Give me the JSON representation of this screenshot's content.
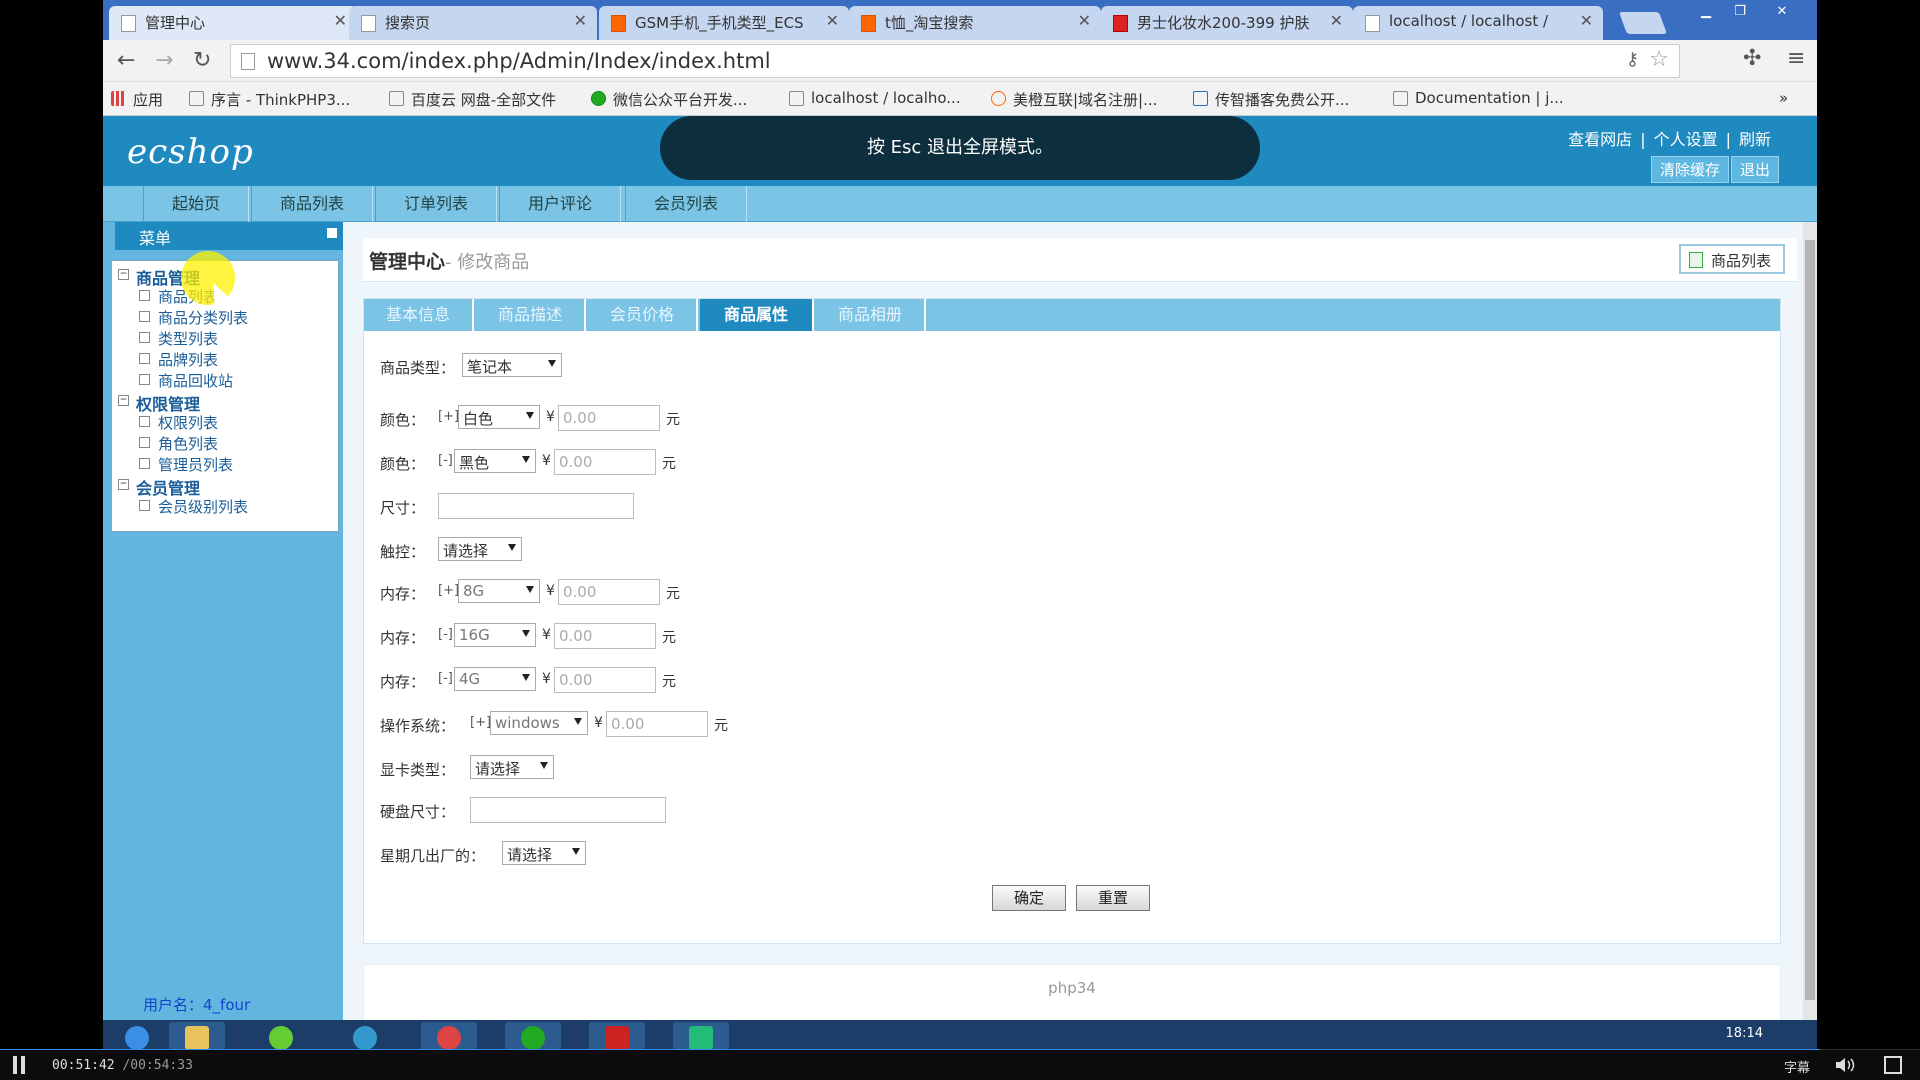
{
  "browser": {
    "tabs": [
      {
        "label": "管理中心",
        "active": true
      },
      {
        "label": "搜索页",
        "active": false
      },
      {
        "label": "GSM手机_手机类型_ECS",
        "active": false
      },
      {
        "label": "t恤_淘宝搜索",
        "active": false
      },
      {
        "label": "男士化妆水200-399 护肤",
        "active": false
      },
      {
        "label": "localhost / localhost / ",
        "active": false
      }
    ],
    "url": "www.34.com/index.php/Admin/Index/index.html",
    "bookmarks": [
      "应用",
      "序言 - ThinkPHP3...",
      "百度云 网盘-全部文件",
      "微信公众平台开发...",
      "localhost / localho...",
      "美橙互联|域名注册|...",
      "传智播客免费公开...",
      "Documentation | j..."
    ]
  },
  "esc_toast": "按 Esc 退出全屏模式。",
  "header": {
    "logo": "ecshop",
    "links": [
      "查看网店",
      "个人设置",
      "刷新"
    ],
    "buttons": [
      "清除缓存",
      "退出"
    ]
  },
  "main_nav": [
    "起始页",
    "商品列表",
    "订单列表",
    "用户评论",
    "会员列表"
  ],
  "sidebar": {
    "title": "菜单",
    "groups": [
      {
        "label": "商品管理",
        "items": [
          "商品列表",
          "商品分类列表",
          "类型列表",
          "品牌列表",
          "商品回收站"
        ]
      },
      {
        "label": "权限管理",
        "items": [
          "权限列表",
          "角色列表",
          "管理员列表"
        ]
      },
      {
        "label": "会员管理",
        "items": [
          "会员级别列表"
        ]
      }
    ],
    "username": "用户名：4_four"
  },
  "page": {
    "title": "管理中心",
    "subtitle": "- 修改商品",
    "list_button": "商品列表",
    "tabs": [
      "基本信息",
      "商品描述",
      "会员价格",
      "商品属性",
      "商品相册"
    ],
    "active_tab": 3,
    "type_label": "商品类型：",
    "type_value": "笔记本",
    "attrs": {
      "color1": {
        "label": "颜色：",
        "mark": "[+]",
        "value": "白色",
        "price": "0.00"
      },
      "color2": {
        "label": "颜色：",
        "mark": "[-]",
        "value": "黑色",
        "price": "0.00"
      },
      "size": {
        "label": "尺寸："
      },
      "touch": {
        "label": "触控：",
        "value": "请选择"
      },
      "mem1": {
        "label": "内存：",
        "mark": "[+]",
        "value": "8G",
        "price": "0.00"
      },
      "mem2": {
        "label": "内存：",
        "mark": "[-]",
        "value": "16G",
        "price": "0.00"
      },
      "mem3": {
        "label": "内存：",
        "mark": "[-]",
        "value": "4G",
        "price": "0.00"
      },
      "os": {
        "label": "操作系统：",
        "mark": "[+]",
        "value": "windows",
        "price": "0.00"
      },
      "gpu": {
        "label": "显卡类型：",
        "value": "请选择"
      },
      "disk": {
        "label": "硬盘尺寸："
      },
      "weekday": {
        "label": "星期几出厂的：",
        "value": "请选择"
      }
    },
    "currency": "¥",
    "unit": "元",
    "submit": "确定",
    "reset": "重置",
    "footer": "php34"
  },
  "taskbar": {
    "time": "18:14"
  },
  "player": {
    "elapsed": "00:51:42",
    "total": "/00:54:33",
    "progress": 0.948,
    "subtitles": "字幕"
  }
}
